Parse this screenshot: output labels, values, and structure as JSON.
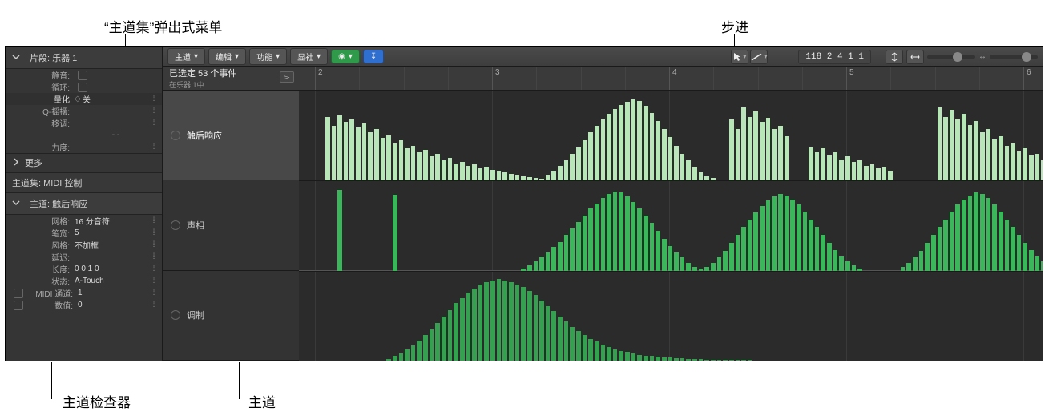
{
  "callouts": {
    "laneset_menu": "“主道集”弹出式菜单",
    "step": "步进",
    "lane_inspector": "主道检查器",
    "lane": "主道"
  },
  "inspector": {
    "region": {
      "label": "片段:",
      "name": "乐器 1"
    },
    "mute_label": "静音:",
    "loop_label": "循环:",
    "quantize_label": "量化",
    "quantize_value": "关",
    "qswing_label": "Q-摇摆:",
    "transpose_label": "移调:",
    "dashes": "- -",
    "velocity_label": "力度:",
    "more": "更多",
    "laneset_label": "主道集:",
    "laneset_value": "MIDI 控制",
    "lane_header_label": "主道:",
    "lane_header_value": "触后响应",
    "grid_label": "网格:",
    "grid_value": "16 分音符",
    "penwidth_label": "笔宽:",
    "penwidth_value": "5",
    "style_label": "风格:",
    "style_value": "不加框",
    "delay_label": "延迟:",
    "length_label": "长度:",
    "length_value": "0 0 1   0",
    "status_label": "状态:",
    "status_value": "A-Touch",
    "midich_label": "MIDI 通道:",
    "midich_value": "1",
    "number_label": "数值:",
    "number_value": "0"
  },
  "toolbar": {
    "lane_btn": "主道",
    "edit_btn": "编辑",
    "func_btn": "功能",
    "view_btn": "显社",
    "display": "118  2 4 1 1"
  },
  "subheader": {
    "selection": "已选定 53 个事件",
    "where": "在乐器 1中"
  },
  "ruler": {
    "marks": [
      "2",
      "3",
      "4",
      "5",
      "6"
    ]
  },
  "lanes": [
    {
      "name": "触后响应",
      "selected": true
    },
    {
      "name": "声相",
      "selected": false
    },
    {
      "name": "调制",
      "selected": false
    }
  ],
  "chart_data": [
    {
      "type": "bar",
      "title": "触后响应",
      "ylim": [
        0,
        127
      ],
      "values": [
        0,
        0,
        0,
        95,
        82,
        98,
        88,
        92,
        80,
        86,
        72,
        78,
        64,
        68,
        56,
        60,
        48,
        52,
        42,
        46,
        36,
        40,
        30,
        34,
        26,
        28,
        22,
        24,
        18,
        20,
        16,
        14,
        12,
        10,
        8,
        6,
        5,
        4,
        3,
        8,
        14,
        22,
        30,
        40,
        50,
        60,
        72,
        82,
        92,
        100,
        108,
        114,
        118,
        122,
        120,
        112,
        102,
        90,
        78,
        65,
        52,
        40,
        30,
        20,
        12,
        6,
        4,
        0,
        0,
        92,
        78,
        110,
        96,
        104,
        88,
        94,
        78,
        82,
        66,
        0,
        0,
        0,
        50,
        42,
        48,
        38,
        42,
        32,
        36,
        28,
        30,
        22,
        24,
        18,
        20,
        14,
        0,
        0,
        0,
        0,
        0,
        0,
        0,
        110,
        96,
        106,
        92,
        100,
        84,
        90,
        72,
        78,
        62,
        66,
        52,
        56,
        44,
        48,
        38,
        40,
        30
      ]
    },
    {
      "type": "bar",
      "title": "声相",
      "ylim": [
        0,
        127
      ],
      "values": [
        0,
        0,
        0,
        0,
        0,
        122,
        0,
        0,
        0,
        0,
        0,
        0,
        0,
        0,
        115,
        0,
        0,
        0,
        0,
        0,
        0,
        0,
        0,
        0,
        0,
        0,
        0,
        0,
        0,
        0,
        0,
        0,
        0,
        0,
        0,
        4,
        8,
        14,
        20,
        28,
        36,
        44,
        54,
        64,
        74,
        84,
        94,
        102,
        110,
        116,
        120,
        118,
        112,
        104,
        94,
        84,
        72,
        60,
        48,
        38,
        28,
        20,
        12,
        6,
        4,
        6,
        12,
        20,
        30,
        42,
        54,
        66,
        78,
        88,
        98,
        106,
        112,
        116,
        114,
        108,
        100,
        90,
        78,
        66,
        54,
        42,
        32,
        22,
        14,
        8,
        4,
        0,
        0,
        0,
        0,
        0,
        0,
        6,
        12,
        20,
        30,
        42,
        54,
        66,
        78,
        90,
        100,
        108,
        114,
        118,
        116,
        110,
        100,
        90,
        78,
        66,
        54,
        42,
        32,
        22,
        14
      ]
    },
    {
      "type": "bar",
      "title": "调制",
      "ylim": [
        0,
        127
      ],
      "values": [
        0,
        0,
        0,
        0,
        0,
        0,
        0,
        0,
        0,
        0,
        0,
        0,
        0,
        4,
        8,
        12,
        18,
        24,
        32,
        40,
        48,
        58,
        68,
        78,
        88,
        96,
        104,
        110,
        116,
        120,
        122,
        124,
        122,
        120,
        116,
        112,
        106,
        100,
        92,
        84,
        76,
        68,
        60,
        52,
        46,
        40,
        34,
        30,
        26,
        22,
        18,
        16,
        14,
        12,
        10,
        9,
        8,
        7,
        6,
        6,
        5,
        5,
        4,
        4,
        4,
        3,
        3,
        3,
        2,
        2,
        2,
        2,
        2,
        1,
        1,
        1,
        1,
        1,
        1,
        1,
        1,
        1,
        1,
        1,
        1,
        1,
        1,
        1,
        1,
        1,
        1,
        1,
        1,
        1,
        1,
        1,
        1,
        1,
        1,
        1,
        1,
        1,
        1,
        1,
        1,
        1,
        1,
        1,
        1,
        1,
        1,
        1,
        1,
        1,
        1,
        1,
        1,
        0,
        0,
        0,
        0
      ]
    }
  ]
}
